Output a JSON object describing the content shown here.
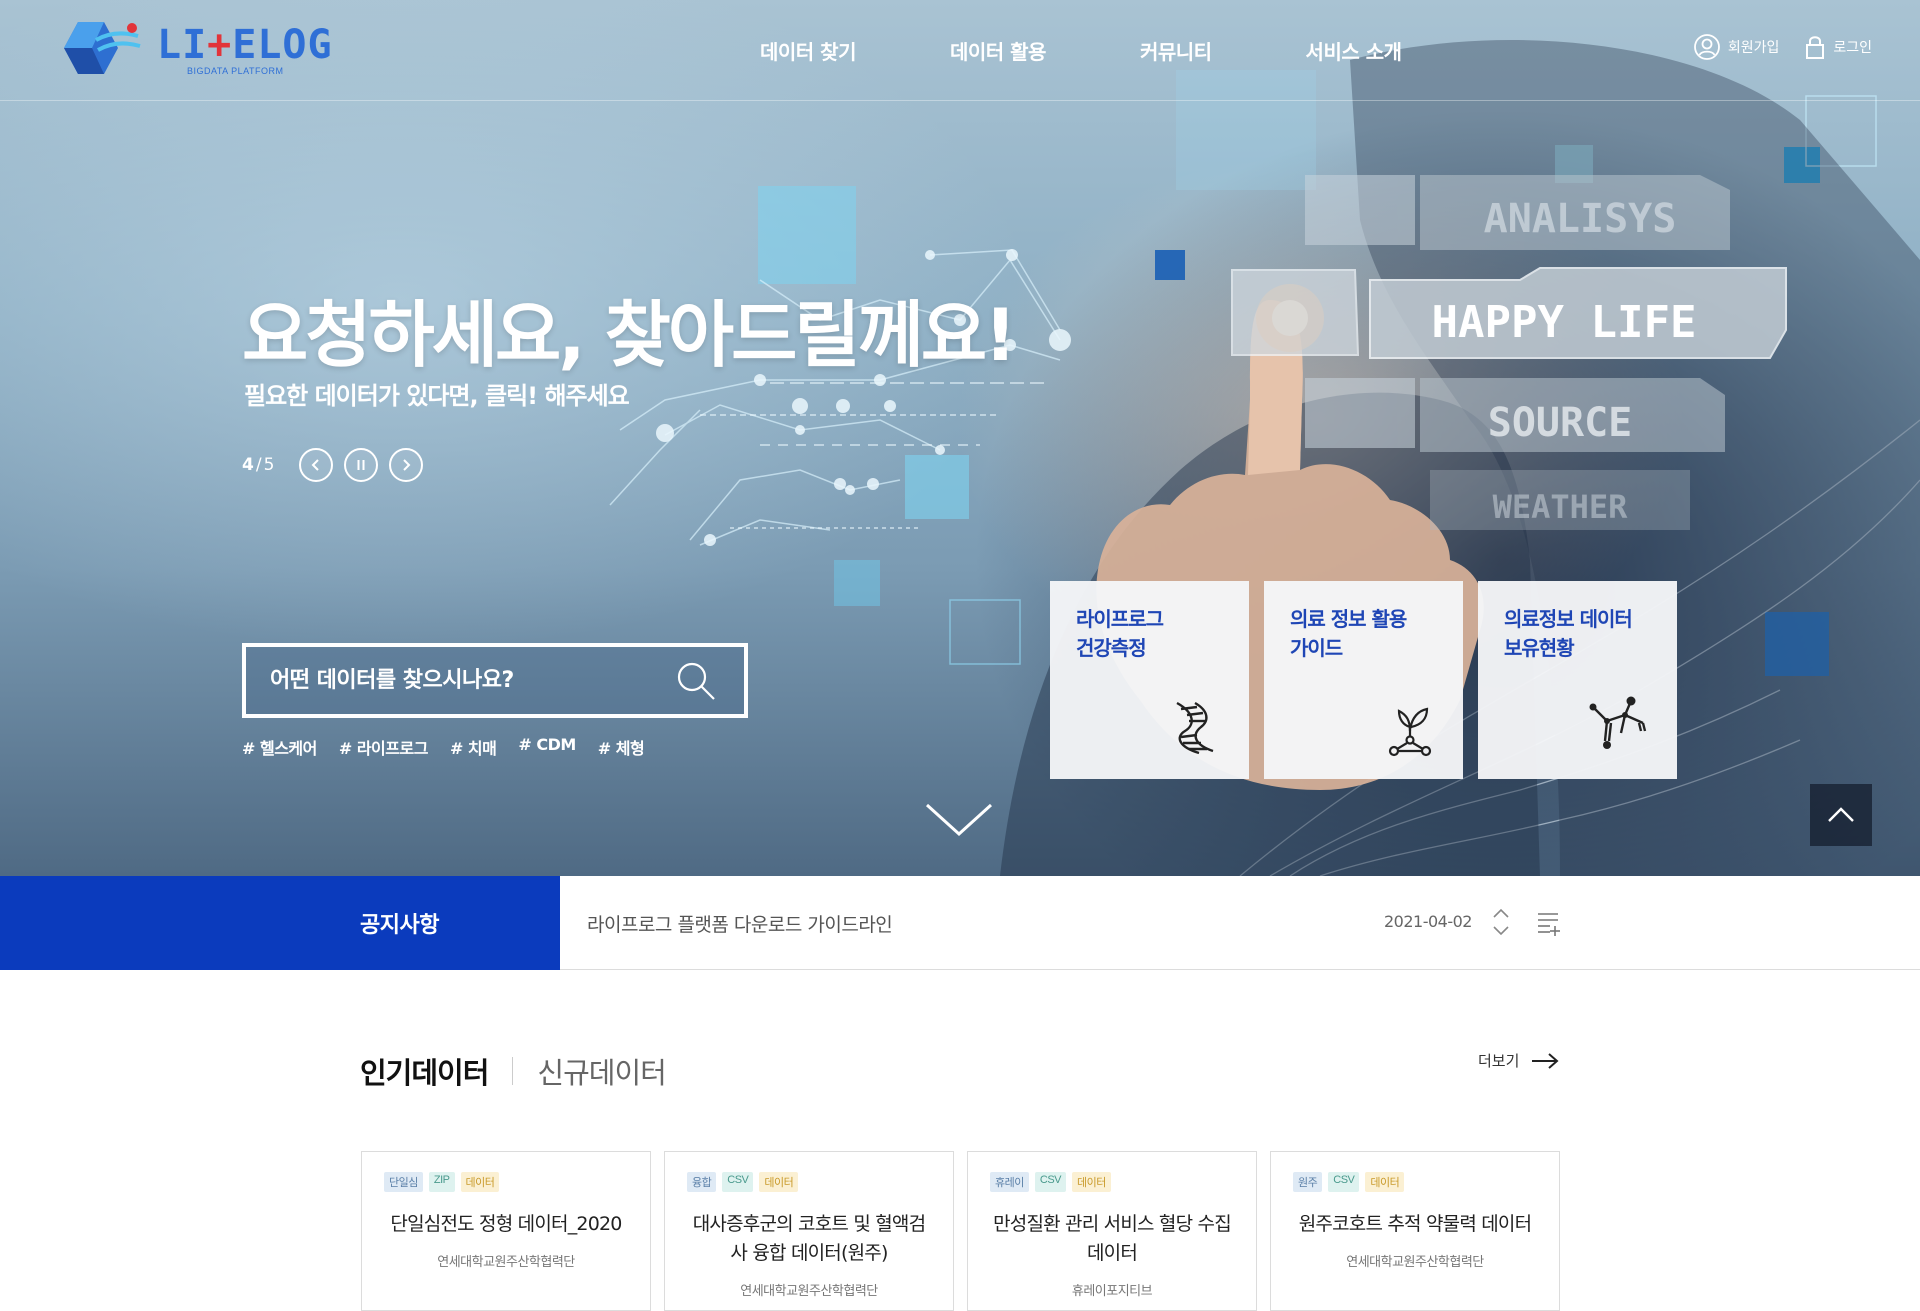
{
  "logo": {
    "text_main": "LI",
    "text_red": "+",
    "text_end": "ELOG",
    "sub": "BIGDATA PLATFORM"
  },
  "nav": [
    "데이터 찾기",
    "데이터 활용",
    "커뮤니티",
    "서비스 소개"
  ],
  "util": {
    "signup": "회원가입",
    "login": "로그인"
  },
  "hero": {
    "title": "요청하세요, 찾아드릴께요!",
    "subtitle": "필요한 데이터가 있다면, 클릭! 해주세요",
    "slide_current": "4",
    "slide_sep": "/",
    "slide_total": "5",
    "hud_labels": [
      "ANALISYS",
      "HAPPY LIFE",
      "SOURCE",
      "WEATHER"
    ]
  },
  "search": {
    "placeholder": "어떤 데이터를 찾으시나요?"
  },
  "tags": [
    "# 헬스케어",
    "# 라이프로그",
    "# 치매",
    "# CDM",
    "# 체형"
  ],
  "quick_cards": [
    {
      "label": "라이프로그\n건강측정",
      "icon": "dna-icon"
    },
    {
      "label": "의료 정보 활용\n가이드",
      "icon": "plant-molecule-icon"
    },
    {
      "label": "의료정보 데이터\n보유현황",
      "icon": "molecule-icon"
    }
  ],
  "notice": {
    "label": "공지사항",
    "text": "라이프로그 플랫폼 다운로드 가이드라인",
    "date": "2021-04-02"
  },
  "section": {
    "tab_active": "인기데이터",
    "tab_inactive": "신규데이터",
    "more": "더보기"
  },
  "data_cards": [
    {
      "badges": [
        "단일심",
        "ZIP",
        "데이터"
      ],
      "title": "단일심전도 정형 데이터_2020",
      "org": "연세대학교원주산학협력단"
    },
    {
      "badges": [
        "융합",
        "CSV",
        "데이터"
      ],
      "title": "대사증후군의 코호트 및 혈액검사 융합 데이터(원주)",
      "org": "연세대학교원주산학협력단"
    },
    {
      "badges": [
        "휴레이",
        "CSV",
        "데이터"
      ],
      "title": "만성질환 관리 서비스 혈당 수집 데이터",
      "org": "휴레이포지티브"
    },
    {
      "badges": [
        "원주",
        "CSV",
        "데이터"
      ],
      "title": "원주코호트 추적 약물력 데이터",
      "org": "연세대학교원주산학협력단"
    }
  ],
  "colors": {
    "brand_blue": "#0b3bbd",
    "card_label_blue": "#1f46b5",
    "logo_blue": "#2f6fd6",
    "logo_red": "#e2343a"
  }
}
